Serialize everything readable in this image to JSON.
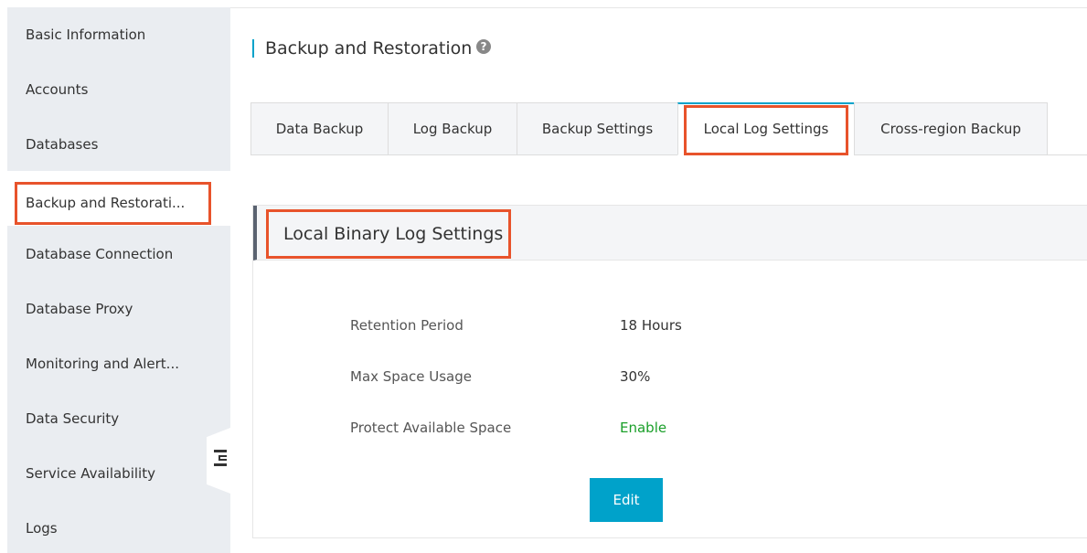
{
  "sidebar": {
    "items": [
      {
        "label": "Basic Information"
      },
      {
        "label": "Accounts"
      },
      {
        "label": "Databases"
      },
      {
        "label": "Backup and Restorati..."
      },
      {
        "label": "Database Connection"
      },
      {
        "label": "Database Proxy"
      },
      {
        "label": "Monitoring and Alert..."
      },
      {
        "label": "Data Security"
      },
      {
        "label": "Service Availability"
      },
      {
        "label": "Logs"
      }
    ],
    "active_index": 3,
    "collapse_icon": "collapse-sidebar-icon"
  },
  "header": {
    "title": "Backup and Restoration",
    "help_icon": "question-circle-icon",
    "help_glyph": "?"
  },
  "tabs": {
    "items": [
      {
        "label": "Data Backup"
      },
      {
        "label": "Log Backup"
      },
      {
        "label": "Backup Settings"
      },
      {
        "label": "Local Log Settings"
      },
      {
        "label": "Cross-region Backup"
      }
    ],
    "active_index": 3
  },
  "panel": {
    "title": "Local Binary Log Settings",
    "fields": [
      {
        "label": "Retention Period",
        "value": "18 Hours"
      },
      {
        "label": "Max Space Usage",
        "value": "30%"
      },
      {
        "label": "Protect Available Space",
        "value": "Enable"
      }
    ],
    "edit_label": "Edit"
  },
  "colors": {
    "accent": "#00a2ca",
    "highlight": "#e8532b",
    "enabled": "#1a9f29",
    "sidebar_bg": "#eaedf1"
  }
}
